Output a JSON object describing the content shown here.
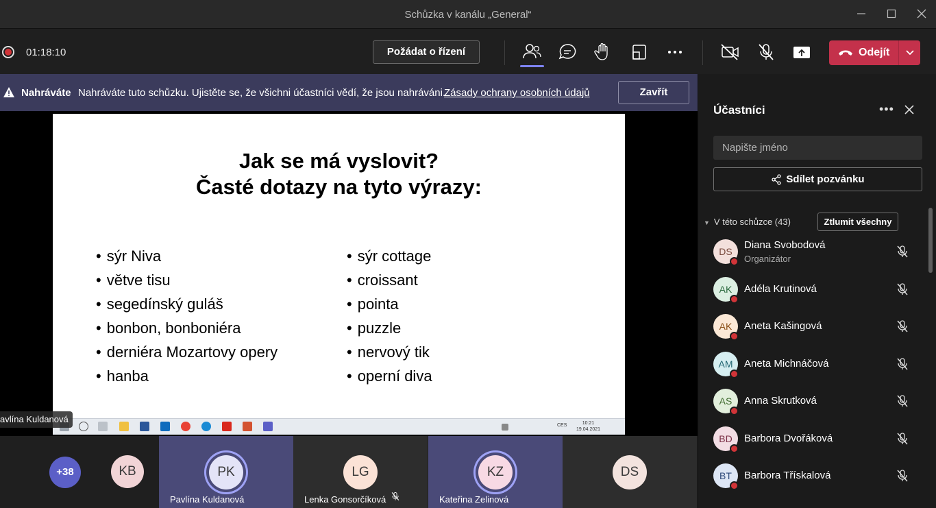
{
  "window": {
    "title": "Schůzka v kanálu „General“",
    "minimize_icon": "minimize-icon",
    "maximize_icon": "maximize-icon",
    "close_icon": "close-icon"
  },
  "toolbar": {
    "recording_indicator": "recording-dot-icon",
    "timer": "01:18:10",
    "request_control_label": "Požádat o řízení",
    "icons": [
      "participants-icon",
      "chat-icon",
      "raise-hand-icon",
      "view-layout-icon",
      "more-actions-icon",
      "camera-off-icon",
      "mic-off-icon",
      "share-screen-icon"
    ],
    "leave_label": "Odejít",
    "leave_color": "#c4314b",
    "accent_color": "#7f85f5"
  },
  "banner": {
    "title": "Nahráváte",
    "text": "Nahráváte tuto schůzku. Ujistěte se, že všichni účastníci vědí, že jsou nahráváni.",
    "link": "Zásady ochrany osobních údajů",
    "close_label": "Zavřít"
  },
  "slide": {
    "title_line1": "Jak se má vyslovit?",
    "title_line2": "Časté dotazy na tyto výrazy:",
    "left_items": [
      "sýr Niva",
      "větve tisu",
      "segedínský guláš",
      "bonbon, bonboniéra",
      "derniéra Mozartovy opery",
      "hanba"
    ],
    "right_items": [
      "sýr cottage",
      "croissant",
      "pointa",
      "puzzle",
      "nervový tik",
      "operní diva"
    ],
    "taskbar_time": "10:21",
    "taskbar_date": "19.04.2021",
    "taskbar_lang": "CES"
  },
  "presenter_name": "avlína Kuldanová",
  "strip": {
    "more_count": "+38",
    "tiles": [
      {
        "initials": "KB",
        "name": "",
        "active": false,
        "avatar_color": "#f1d4d6"
      },
      {
        "initials": "PK",
        "name": "Pavlína Kuldanová",
        "active": true,
        "avatar_color": "#e4e4f7"
      },
      {
        "initials": "LG",
        "name": "Lenka Gonsorčíková",
        "active": false,
        "avatar_color": "#fbe2d6",
        "muted": true
      },
      {
        "initials": "KZ",
        "name": "Kateřina Zelinová",
        "active": true,
        "avatar_color": "#f7d9e4"
      },
      {
        "initials": "DS",
        "name": "",
        "active": false,
        "avatar_color": "#f3e3de"
      }
    ]
  },
  "panel": {
    "title": "Účastníci",
    "search_placeholder": "Napište jméno",
    "share_label": "Sdílet pozvánku",
    "section_label": "V této schůzce (43)",
    "mute_all_label": "Ztlumit všechny",
    "participants": [
      {
        "initials": "DS",
        "name": "Diana Svobodová",
        "role": "Organizátor",
        "avatar_bg": "#f3e0dc",
        "avatar_fg": "#7a4a3d"
      },
      {
        "initials": "AK",
        "name": "Adéla Krutinová",
        "role": "",
        "avatar_bg": "#dcefe2",
        "avatar_fg": "#2e6b40"
      },
      {
        "initials": "AK",
        "name": "Aneta Kašingová",
        "role": "",
        "avatar_bg": "#fbe8d6",
        "avatar_fg": "#8a4e16"
      },
      {
        "initials": "AM",
        "name": "Aneta Michnáčová",
        "role": "",
        "avatar_bg": "#d6eef1",
        "avatar_fg": "#1f6470"
      },
      {
        "initials": "AS",
        "name": "Anna Skrutková",
        "role": "",
        "avatar_bg": "#e2efdc",
        "avatar_fg": "#3f6b2e"
      },
      {
        "initials": "BD",
        "name": "Barbora Dvořáková",
        "role": "",
        "avatar_bg": "#f3dde4",
        "avatar_fg": "#7a2e45"
      },
      {
        "initials": "BT",
        "name": "Barbora Třískalová",
        "role": "",
        "avatar_bg": "#dde6f5",
        "avatar_fg": "#2e4a7a"
      }
    ]
  }
}
